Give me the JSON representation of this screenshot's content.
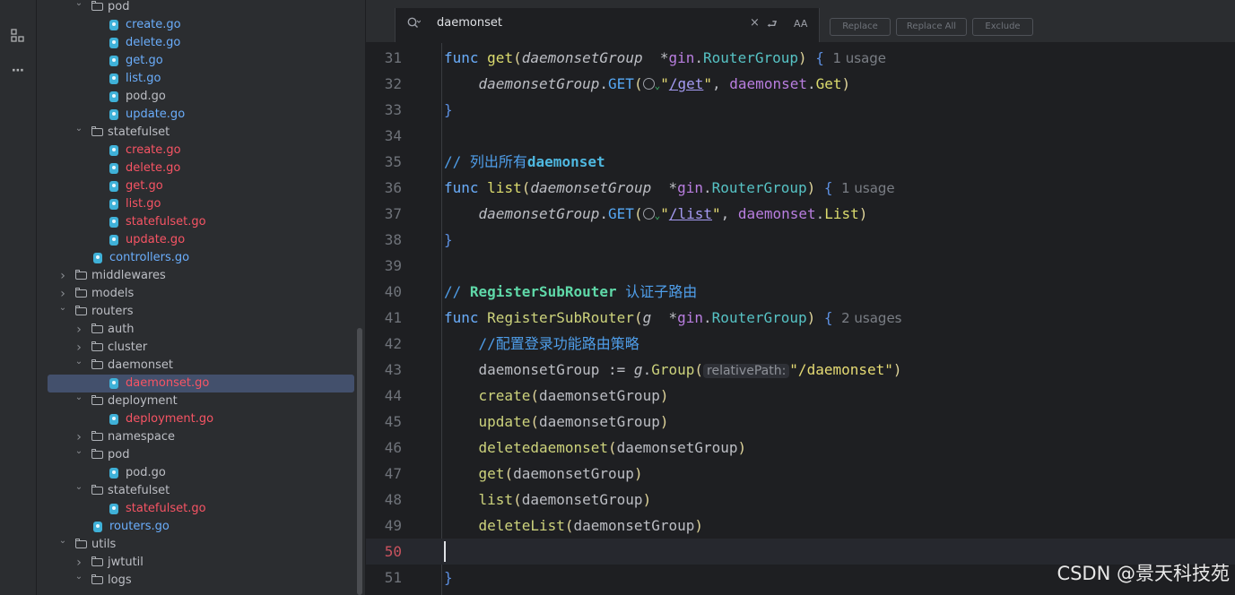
{
  "activity_bar": {
    "icons": [
      "structure-icon",
      "more-icon"
    ],
    "more_label": "⋯"
  },
  "tree": {
    "rows": [
      {
        "type": "folder",
        "label": "pod",
        "depth": 2,
        "open": true,
        "color": "normal"
      },
      {
        "type": "file",
        "label": "create.go",
        "depth": 3,
        "color": "blue"
      },
      {
        "type": "file",
        "label": "delete.go",
        "depth": 3,
        "color": "blue"
      },
      {
        "type": "file",
        "label": "get.go",
        "depth": 3,
        "color": "blue"
      },
      {
        "type": "file",
        "label": "list.go",
        "depth": 3,
        "color": "blue"
      },
      {
        "type": "file",
        "label": "pod.go",
        "depth": 3,
        "color": "normal"
      },
      {
        "type": "file",
        "label": "update.go",
        "depth": 3,
        "color": "blue"
      },
      {
        "type": "folder",
        "label": "statefulset",
        "depth": 2,
        "open": true,
        "color": "normal"
      },
      {
        "type": "file",
        "label": "create.go",
        "depth": 3,
        "color": "red"
      },
      {
        "type": "file",
        "label": "delete.go",
        "depth": 3,
        "color": "red"
      },
      {
        "type": "file",
        "label": "get.go",
        "depth": 3,
        "color": "red"
      },
      {
        "type": "file",
        "label": "list.go",
        "depth": 3,
        "color": "red"
      },
      {
        "type": "file",
        "label": "statefulset.go",
        "depth": 3,
        "color": "red"
      },
      {
        "type": "file",
        "label": "update.go",
        "depth": 3,
        "color": "red"
      },
      {
        "type": "file",
        "label": "controllers.go",
        "depth": 2,
        "color": "blue"
      },
      {
        "type": "folder",
        "label": "middlewares",
        "depth": 1,
        "open": false,
        "color": "normal"
      },
      {
        "type": "folder",
        "label": "models",
        "depth": 1,
        "open": false,
        "color": "normal"
      },
      {
        "type": "folder",
        "label": "routers",
        "depth": 1,
        "open": true,
        "color": "normal"
      },
      {
        "type": "folder",
        "label": "auth",
        "depth": 2,
        "open": false,
        "color": "normal"
      },
      {
        "type": "folder",
        "label": "cluster",
        "depth": 2,
        "open": false,
        "color": "normal"
      },
      {
        "type": "folder",
        "label": "daemonset",
        "depth": 2,
        "open": true,
        "color": "normal"
      },
      {
        "type": "file",
        "label": "daemonset.go",
        "depth": 3,
        "color": "red",
        "selected": true
      },
      {
        "type": "folder",
        "label": "deployment",
        "depth": 2,
        "open": true,
        "color": "normal"
      },
      {
        "type": "file",
        "label": "deployment.go",
        "depth": 3,
        "color": "red"
      },
      {
        "type": "folder",
        "label": "namespace",
        "depth": 2,
        "open": false,
        "color": "normal"
      },
      {
        "type": "folder",
        "label": "pod",
        "depth": 2,
        "open": true,
        "color": "normal"
      },
      {
        "type": "file",
        "label": "pod.go",
        "depth": 3,
        "color": "normal"
      },
      {
        "type": "folder",
        "label": "statefulset",
        "depth": 2,
        "open": true,
        "color": "normal"
      },
      {
        "type": "file",
        "label": "statefulset.go",
        "depth": 3,
        "color": "red"
      },
      {
        "type": "file",
        "label": "routers.go",
        "depth": 2,
        "color": "blue"
      },
      {
        "type": "folder",
        "label": "utils",
        "depth": 1,
        "open": true,
        "color": "normal"
      },
      {
        "type": "folder",
        "label": "jwtutil",
        "depth": 2,
        "open": false,
        "color": "normal"
      },
      {
        "type": "folder",
        "label": "logs",
        "depth": 2,
        "open": true,
        "color": "normal"
      }
    ]
  },
  "find": {
    "query": "daemonset",
    "clear_glyph": "×",
    "wrap_glyph": "⮐",
    "case_glyph": "AA",
    "replace_label": "Replace",
    "replace_all_label": "Replace All",
    "exclude_label": "Exclude"
  },
  "editor": {
    "current_line": 50,
    "lines": [
      {
        "n": "31",
        "seg": [
          [
            "kw2",
            "func "
          ],
          [
            "fn-y",
            "get"
          ],
          [
            "punc",
            "("
          ],
          [
            "param",
            "daemonsetGroup"
          ],
          [
            "",
            "  *"
          ],
          [
            "pkg",
            "gin"
          ],
          [
            "",
            "."
          ],
          [
            "type",
            "RouterGroup"
          ],
          [
            "punc",
            ")"
          ],
          [
            "",
            " "
          ],
          [
            "brace",
            "{"
          ],
          [
            "hint",
            "  1 usage"
          ]
        ]
      },
      {
        "n": "32",
        "seg": [
          [
            "",
            "    "
          ],
          [
            "param",
            "daemonsetGroup"
          ],
          [
            "",
            "."
          ],
          [
            "fn",
            "GET"
          ],
          [
            "punc",
            "("
          ],
          [
            "globe",
            ""
          ],
          [
            "globe-chev",
            "⌄"
          ],
          [
            "str",
            "\""
          ],
          [
            "strlink",
            "/get"
          ],
          [
            "str",
            "\""
          ],
          [
            "",
            ", "
          ],
          [
            "pkg",
            "daemonset"
          ],
          [
            "",
            "."
          ],
          [
            "fn-y",
            "Get"
          ],
          [
            "punc",
            ")"
          ]
        ]
      },
      {
        "n": "33",
        "seg": [
          [
            "brace",
            "}"
          ]
        ]
      },
      {
        "n": "34",
        "seg": []
      },
      {
        "n": "35",
        "seg": [
          [
            "cmt",
            "// 列出所有"
          ],
          [
            "cmt-b",
            "daemonset"
          ]
        ]
      },
      {
        "n": "36",
        "seg": [
          [
            "kw2",
            "func "
          ],
          [
            "fn-y",
            "list"
          ],
          [
            "punc",
            "("
          ],
          [
            "param",
            "daemonsetGroup"
          ],
          [
            "",
            "  *"
          ],
          [
            "pkg",
            "gin"
          ],
          [
            "",
            "."
          ],
          [
            "type",
            "RouterGroup"
          ],
          [
            "punc",
            ")"
          ],
          [
            "",
            " "
          ],
          [
            "brace",
            "{"
          ],
          [
            "hint",
            "  1 usage"
          ]
        ]
      },
      {
        "n": "37",
        "seg": [
          [
            "",
            "    "
          ],
          [
            "param",
            "daemonsetGroup"
          ],
          [
            "",
            "."
          ],
          [
            "fn",
            "GET"
          ],
          [
            "punc",
            "("
          ],
          [
            "globe",
            ""
          ],
          [
            "globe-chev",
            "⌄"
          ],
          [
            "str",
            "\""
          ],
          [
            "strlink",
            "/list"
          ],
          [
            "str",
            "\""
          ],
          [
            "",
            ", "
          ],
          [
            "pkg",
            "daemonset"
          ],
          [
            "",
            "."
          ],
          [
            "fn-y",
            "List"
          ],
          [
            "punc",
            ")"
          ]
        ]
      },
      {
        "n": "38",
        "seg": [
          [
            "brace",
            "}"
          ]
        ]
      },
      {
        "n": "39",
        "seg": []
      },
      {
        "n": "40",
        "seg": [
          [
            "cmt",
            "// "
          ],
          [
            "cmt-g",
            "RegisterSubRouter"
          ],
          [
            "cmt",
            " 认证子路由"
          ]
        ]
      },
      {
        "n": "41",
        "seg": [
          [
            "kw2",
            "func "
          ],
          [
            "fn-g",
            "RegisterSubRouter"
          ],
          [
            "punc",
            "("
          ],
          [
            "param",
            "g"
          ],
          [
            "",
            "  *"
          ],
          [
            "pkg",
            "gin"
          ],
          [
            "",
            "."
          ],
          [
            "type",
            "RouterGroup"
          ],
          [
            "punc",
            ")"
          ],
          [
            "",
            " "
          ],
          [
            "brace",
            "{"
          ],
          [
            "hint",
            "  2 usages"
          ]
        ]
      },
      {
        "n": "42",
        "seg": [
          [
            "",
            "    "
          ],
          [
            "cmt",
            "//配置登录功能路由策略"
          ]
        ]
      },
      {
        "n": "43",
        "seg": [
          [
            "",
            "    daemonsetGroup := "
          ],
          [
            "param",
            "g"
          ],
          [
            "",
            "."
          ],
          [
            "fn-g",
            "Group"
          ],
          [
            "punc",
            "("
          ],
          [
            "inlay",
            "relativePath:"
          ],
          [
            "str",
            "\"/daemonset\""
          ],
          [
            "punc",
            ")"
          ]
        ]
      },
      {
        "n": "44",
        "seg": [
          [
            "",
            "    "
          ],
          [
            "fn-g",
            "create"
          ],
          [
            "punc",
            "("
          ],
          [
            "",
            "daemonsetGroup"
          ],
          [
            "punc",
            ")"
          ]
        ]
      },
      {
        "n": "45",
        "seg": [
          [
            "",
            "    "
          ],
          [
            "fn-g",
            "update"
          ],
          [
            "punc",
            "("
          ],
          [
            "",
            "daemonsetGroup"
          ],
          [
            "punc",
            ")"
          ]
        ]
      },
      {
        "n": "46",
        "seg": [
          [
            "",
            "    "
          ],
          [
            "fn-g",
            "deletedaemonset"
          ],
          [
            "punc",
            "("
          ],
          [
            "",
            "daemonsetGroup"
          ],
          [
            "punc",
            ")"
          ]
        ]
      },
      {
        "n": "47",
        "seg": [
          [
            "",
            "    "
          ],
          [
            "fn-g",
            "get"
          ],
          [
            "punc",
            "("
          ],
          [
            "",
            "daemonsetGroup"
          ],
          [
            "punc",
            ")"
          ]
        ]
      },
      {
        "n": "48",
        "seg": [
          [
            "",
            "    "
          ],
          [
            "fn-g",
            "list"
          ],
          [
            "punc",
            "("
          ],
          [
            "",
            "daemonsetGroup"
          ],
          [
            "punc",
            ")"
          ]
        ]
      },
      {
        "n": "49",
        "seg": [
          [
            "",
            "    "
          ],
          [
            "fn-g",
            "deleteList"
          ],
          [
            "punc",
            "("
          ],
          [
            "",
            "daemonsetGroup"
          ],
          [
            "punc",
            ")"
          ]
        ]
      },
      {
        "n": "50",
        "seg": []
      },
      {
        "n": "51",
        "seg": [
          [
            "brace",
            "}"
          ]
        ]
      }
    ]
  },
  "watermark": "CSDN @景天科技苑"
}
